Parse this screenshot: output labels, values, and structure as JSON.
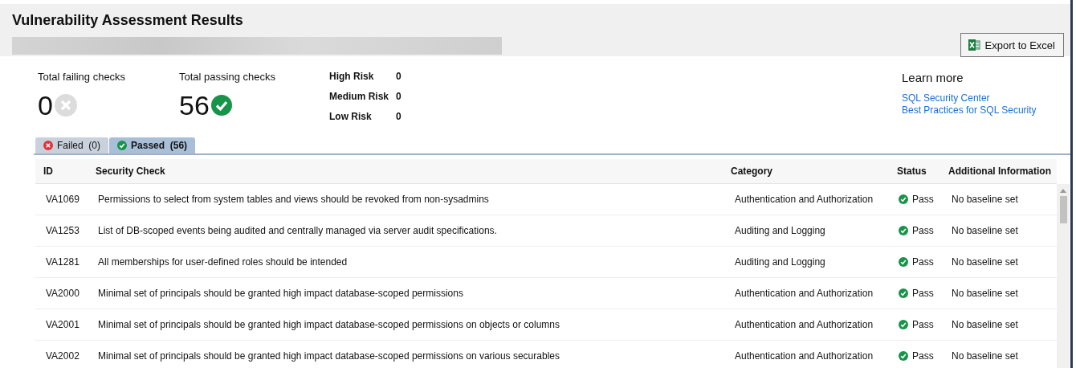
{
  "header": {
    "title": "Vulnerability Assessment Results",
    "export_button": "Export to Excel"
  },
  "totals": [
    {
      "kind": "failing",
      "label": "Total failing checks",
      "value": "0"
    },
    {
      "kind": "passing",
      "label": "Total passing checks",
      "value": "56"
    }
  ],
  "risks": [
    {
      "label": "High Risk",
      "value": "0"
    },
    {
      "label": "Medium Risk",
      "value": "0"
    },
    {
      "label": "Low Risk",
      "value": "0"
    }
  ],
  "learn_more": {
    "title": "Learn more",
    "links": [
      "SQL Security Center",
      "Best Practices for SQL Security"
    ]
  },
  "tabs": [
    {
      "kind": "failed",
      "label": "Failed",
      "count": "(0)",
      "selected": false
    },
    {
      "kind": "passed",
      "label": "Passed",
      "count": "(56)",
      "selected": true
    }
  ],
  "table": {
    "columns": [
      "ID",
      "Security Check",
      "Category",
      "Status",
      "Additional Information"
    ],
    "rows": [
      {
        "id": "VA1069",
        "check": "Permissions to select from system tables and views should be revoked from non-sysadmins",
        "category": "Authentication and Authorization",
        "kind": "pass",
        "status": "Pass",
        "info": "No baseline set"
      },
      {
        "id": "VA1253",
        "check": "List of DB-scoped events being audited and centrally managed via server audit specifications.",
        "category": "Auditing and Logging",
        "kind": "pass",
        "status": "Pass",
        "info": "No baseline set"
      },
      {
        "id": "VA1281",
        "check": "All memberships for user-defined roles should be intended",
        "category": "Auditing and Logging",
        "kind": "pass",
        "status": "Pass",
        "info": "No baseline set"
      },
      {
        "id": "VA2000",
        "check": "Minimal set of principals should be granted high impact database-scoped permissions",
        "category": "Authentication and Authorization",
        "kind": "pass",
        "status": "Pass",
        "info": "No baseline set"
      },
      {
        "id": "VA2001",
        "check": "Minimal set of principals should be granted high impact database-scoped permissions on objects or columns",
        "category": "Authentication and Authorization",
        "kind": "pass",
        "status": "Pass",
        "info": "No baseline set"
      },
      {
        "id": "VA2002",
        "check": "Minimal set of principals should be granted high impact database-scoped permissions on various securables",
        "category": "Authentication and Authorization",
        "kind": "pass",
        "status": "Pass",
        "info": "No baseline set"
      }
    ]
  }
}
